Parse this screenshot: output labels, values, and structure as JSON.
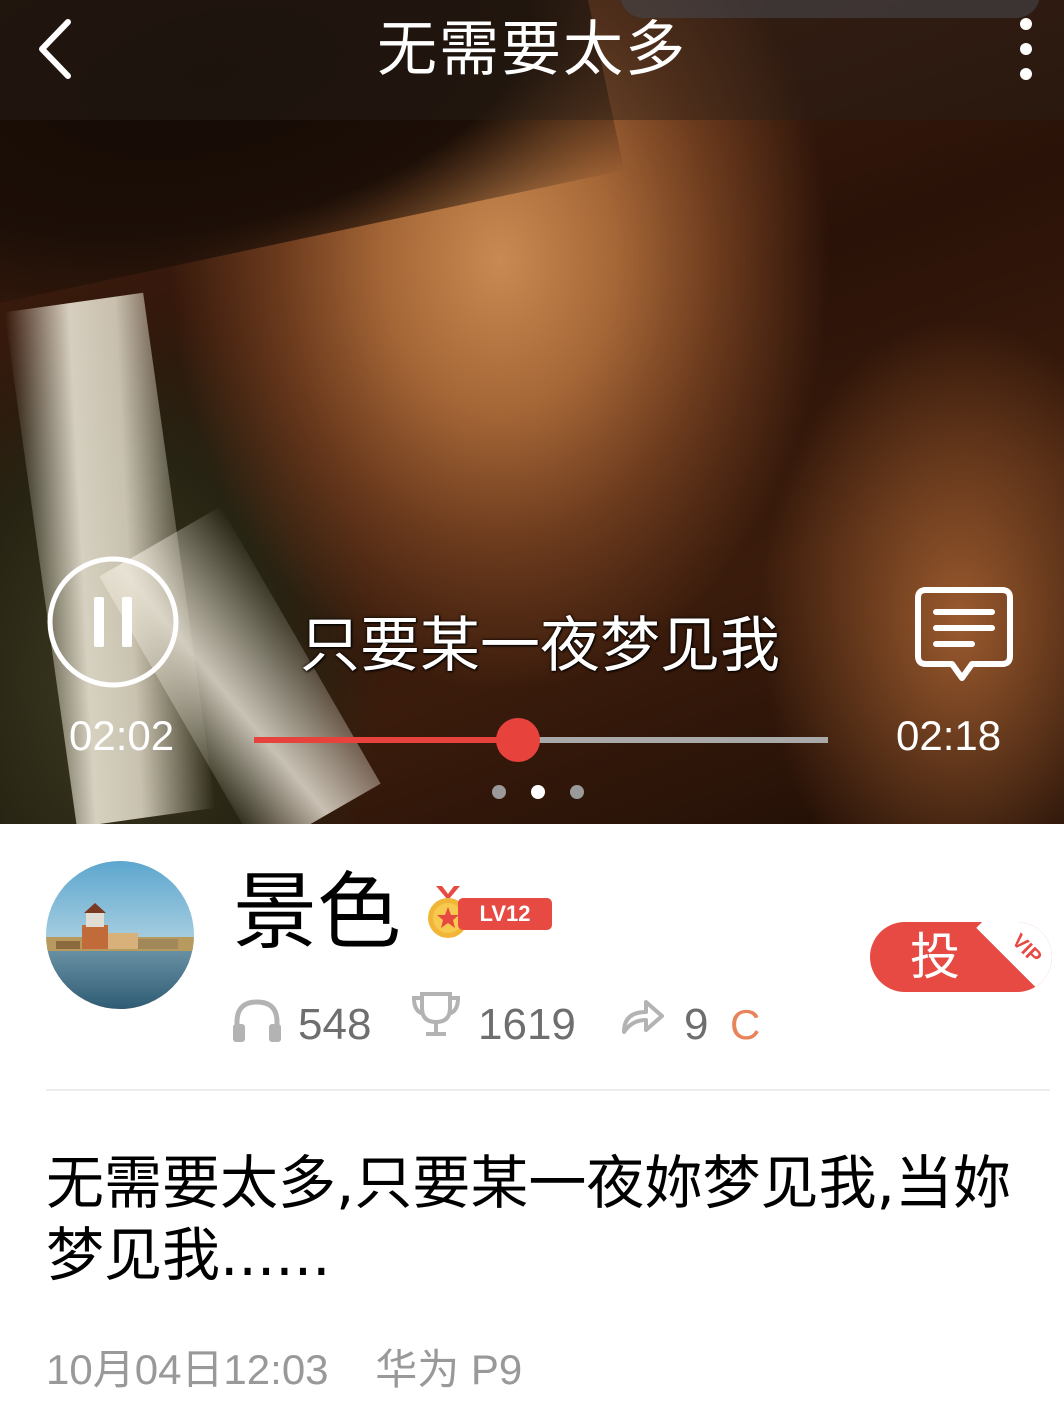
{
  "header": {
    "title": "无需要太多"
  },
  "player": {
    "lyric": "只要某一夜梦见我",
    "current_time": "02:02",
    "total_time": "02:18",
    "progress": 0.46,
    "page_count": 3,
    "active_page": 1,
    "state": "playing"
  },
  "profile": {
    "name": "景色",
    "level": "LV12",
    "listens": "548",
    "trophies": "1619",
    "shares": "9",
    "coin_symbol": "C"
  },
  "vote_button": {
    "label": "投",
    "badge": "VIP"
  },
  "post": {
    "description": "无需要太多,只要某一夜妳梦见我,当妳梦见我......",
    "meta": "10月04日12:03    华为 P9"
  },
  "colors": {
    "accent": "#e64a42",
    "progress_fill": "#e8423c",
    "progress_track": "#a9a9a9",
    "coin": "#e8835a",
    "meta_text": "#999999",
    "stat_text": "#6e6e6e"
  },
  "icons": [
    "back-icon",
    "more-icon",
    "pause-icon",
    "comment-icon",
    "headphones-icon",
    "trophy-icon",
    "share-icon",
    "medal-icon"
  ]
}
